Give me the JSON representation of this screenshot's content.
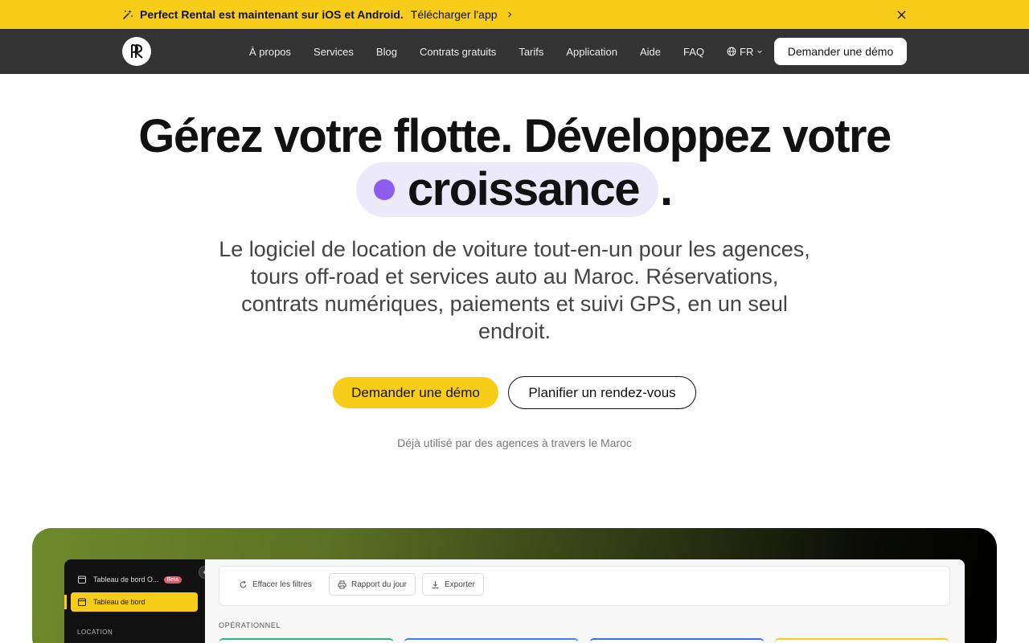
{
  "announcement": {
    "icon": "sparkle-icon",
    "text": "Perfect Rental est maintenant sur iOS et Android.",
    "link_label": "Télécharger l'app",
    "close_icon": "close-icon"
  },
  "navbar": {
    "logo_text": "PR",
    "links": [
      "À propos",
      "Services",
      "Blog",
      "Contrats gratuits",
      "Tarifs",
      "Application",
      "Aide",
      "FAQ"
    ],
    "language": "FR",
    "cta_label": "Demander une démo"
  },
  "hero": {
    "title_line1": "Gérez votre flotte. Développez votre",
    "highlight_word": "croissance",
    "period": ".",
    "subtitle": "Le logiciel de location de voiture tout-en-un pour les agences, tours off-road et services auto au Maroc. Réservations, contrats numériques, paiements et suivi GPS, en un seul endroit.",
    "primary_cta": "Demander une démo",
    "secondary_cta": "Planifier un rendez-vous",
    "trust_text": "Déjà utilisé par des agences à travers le Maroc"
  },
  "dashboard_preview": {
    "sidebar": {
      "item_1": "Tableau de bord O...",
      "item_1_badge": "Beta",
      "active_item": "Tableau de bord",
      "section_label": "LOCATION"
    },
    "toolbar": {
      "clear_filters": "Effacer les filtres",
      "daily_report": "Rapport du jour",
      "export": "Exporter"
    },
    "section_label": "OPÉRATIONNEL",
    "card_accent_colors": [
      "#2fb67a",
      "#3b82f6",
      "#3b6ef0",
      "#f7cd19"
    ]
  },
  "colors": {
    "brand_yellow": "#f7cd19",
    "nav_background": "#333333",
    "highlight_pill": "#ece9fb",
    "highlight_dot": "#8f5cf0"
  }
}
